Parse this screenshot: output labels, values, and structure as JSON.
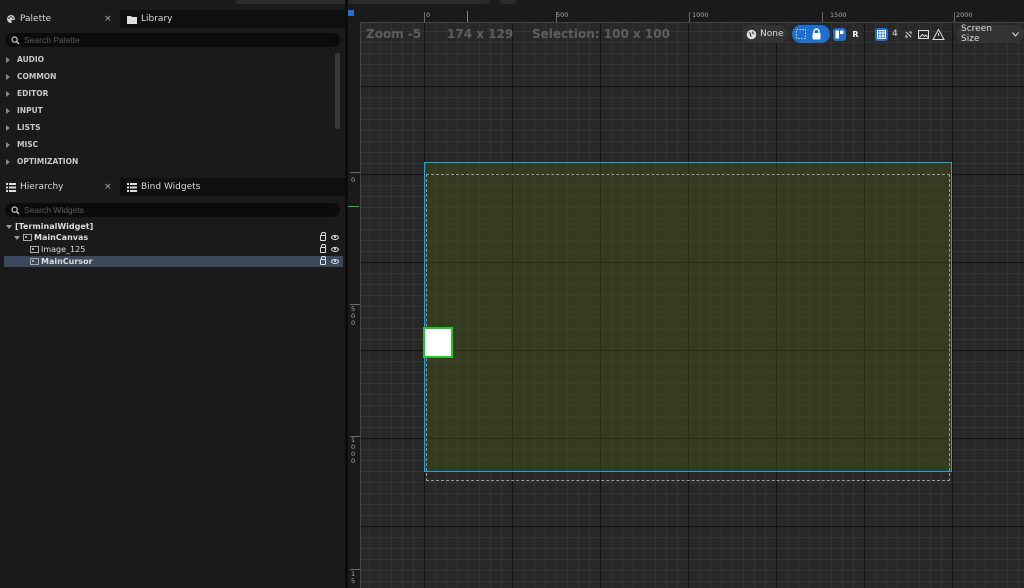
{
  "colors": {
    "accent_blue": "#1e6fd0",
    "selection_cyan": "#19a7e0",
    "selection_green": "#21c82a",
    "canvas_fill": "#465519"
  },
  "palette": {
    "tab_label": "Palette",
    "tab_icon": "paint-palette-icon",
    "library_tab_label": "Library",
    "library_tab_icon": "folder-icon",
    "close_symbol": "×",
    "search_placeholder": "Search Palette",
    "categories": [
      "AUDIO",
      "COMMON",
      "EDITOR",
      "INPUT",
      "LISTS",
      "MISC",
      "OPTIMIZATION"
    ]
  },
  "hierarchy": {
    "tab_label": "Hierarchy",
    "tab_icon": "hierarchy-list-icon",
    "bind_tab_label": "Bind Widgets",
    "bind_tab_icon": "bind-list-icon",
    "close_symbol": "×",
    "search_placeholder": "Search Widgets",
    "items": [
      {
        "label": "[TerminalWidget]"
      },
      {
        "label": "MainCanvas"
      },
      {
        "label": "Image_125"
      },
      {
        "label": "MainCursor"
      }
    ]
  },
  "viewport": {
    "zoom_label": "Zoom -5",
    "cursor_position": "174 x 129",
    "selection_label": "Selection: 100 x 100",
    "toolbar": {
      "localization_value": "None",
      "respect_locks_label": "R",
      "grid_value": "4",
      "screen_size_label": "Screen Size"
    },
    "hruler_labels": [
      "0",
      "500",
      "1000",
      "1500",
      "2000"
    ],
    "vruler_labels": [
      "0",
      "5\n0\n0",
      "1\n0\n0\n0",
      "1\n5"
    ]
  }
}
